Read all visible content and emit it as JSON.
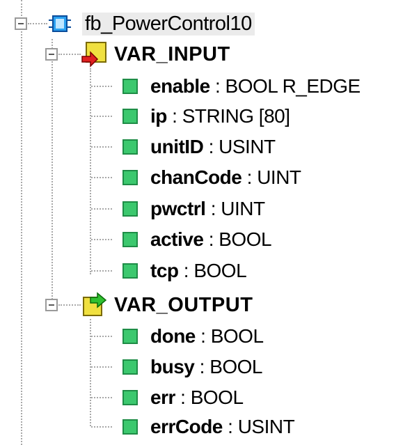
{
  "tree": {
    "root": {
      "name": "fb_PowerControl10",
      "icon": "function-block-icon"
    },
    "groups": [
      {
        "label": "VAR_INPUT",
        "icon": "input-folder-icon",
        "items": [
          {
            "name": "enable",
            "type": ": BOOL R_EDGE"
          },
          {
            "name": "ip",
            "type": ": STRING [80]"
          },
          {
            "name": "unitID",
            "type": ": USINT"
          },
          {
            "name": "chanCode",
            "type": ": UINT"
          },
          {
            "name": "pwctrl",
            "type": ": UINT"
          },
          {
            "name": "active",
            "type": ": BOOL"
          },
          {
            "name": "tcp",
            "type": ": BOOL"
          }
        ]
      },
      {
        "label": "VAR_OUTPUT",
        "icon": "output-folder-icon",
        "items": [
          {
            "name": "done",
            "type": ": BOOL"
          },
          {
            "name": "busy",
            "type": ": BOOL"
          },
          {
            "name": "err",
            "type": ": BOOL"
          },
          {
            "name": "errCode",
            "type": ": USINT"
          }
        ]
      }
    ]
  },
  "colors": {
    "variable": "#3cc86e",
    "folder": "#f0e040",
    "arrow_in": "#e02020",
    "arrow_out": "#30c030",
    "fb_icon": "#2aa0f0"
  }
}
